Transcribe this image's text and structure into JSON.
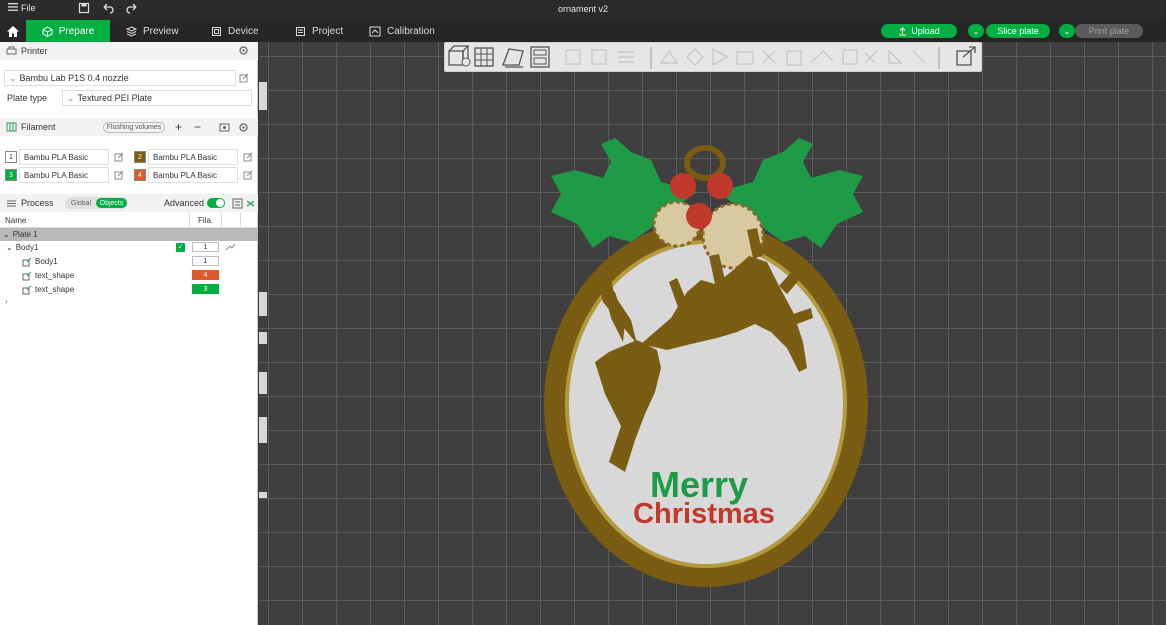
{
  "titlebar": {
    "menu_label": "File",
    "title": "ornament v2"
  },
  "tabs": [
    {
      "label": "Prepare"
    },
    {
      "label": "Preview"
    },
    {
      "label": "Device"
    },
    {
      "label": "Project"
    },
    {
      "label": "Calibration"
    }
  ],
  "actions": {
    "upload": "Upload",
    "slice": "Slice plate",
    "print": "Print plate"
  },
  "printer": {
    "section_title": "Printer",
    "model": "Bambu Lab P1S 0.4 nozzle",
    "plate_type_label": "Plate type",
    "plate_type_value": "Textured PEI Plate"
  },
  "filament": {
    "section_title": "Filament",
    "flushing_label": "Flushing volumes",
    "items": [
      {
        "num": "1",
        "name": "Bambu PLA Basic",
        "color": "#ffffff",
        "text_color": "#333333"
      },
      {
        "num": "2",
        "name": "Bambu PLA Basic",
        "color": "#7a5c12",
        "text_color": "#ffffff"
      },
      {
        "num": "3",
        "name": "Bambu PLA Basic",
        "color": "#00ae42",
        "text_color": "#ffffff"
      },
      {
        "num": "4",
        "name": "Bambu PLA Basic",
        "color": "#e0592a",
        "text_color": "#ffffff"
      }
    ]
  },
  "process": {
    "section_title": "Process",
    "global_label": "Global",
    "objects_label": "Objects",
    "advanced_label": "Advanced",
    "advanced_on": true
  },
  "tree": {
    "col_name": "Name",
    "col_fila": "Fila.",
    "plate_label": "Plate 1",
    "object_name": "Body1",
    "object_fila": "1",
    "parts": [
      {
        "name": "Body1",
        "fila": "1",
        "fila_color": "#ffffff",
        "fila_text": "#333333"
      },
      {
        "name": "text_shape",
        "fila": "4",
        "fila_color": "#e0592a",
        "fila_text": "#ffffff"
      },
      {
        "name": "text_shape",
        "fila": "3",
        "fila_color": "#00ae42",
        "fila_text": "#ffffff"
      }
    ]
  },
  "model": {
    "line1": "Merry",
    "line2": "Christmas",
    "line1_color": "#1f9a46",
    "line2_color": "#c0392b",
    "frame_color": "#7a5c12",
    "holly_color": "#1f9a46",
    "berry_color": "#c0392b",
    "inner_color": "#d8d8d8"
  }
}
